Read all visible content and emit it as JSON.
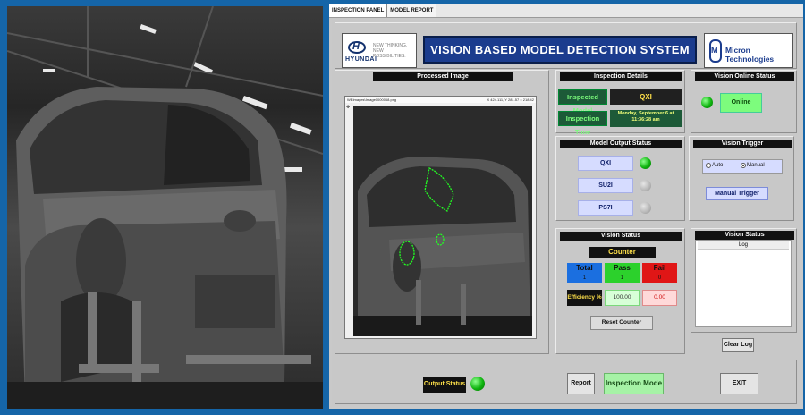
{
  "tabs": [
    "INSPECTION PANEL",
    "MODEL REPORT"
  ],
  "header": {
    "hyundai_brand": "HYUNDAI",
    "hyundai_tagline": "NEW THINKING. NEW POSSIBILITIES.",
    "title": "VISION BASED MODEL DETECTION SYSTEM",
    "company": "Micron Technologies"
  },
  "processed_image": {
    "title": "Processed Image",
    "file_path": "WEImages\\Image0000068.png",
    "coords": "X 424.111, Y 281.57 = 218.42"
  },
  "inspection_details": {
    "title": "Inspection Details",
    "model_label": "Inspected Model",
    "model_value": "QXI",
    "time_label": "Inspection Time",
    "time_value": "Monday, September 6 at 11:36:28 am"
  },
  "vision_online": {
    "title": "Vision Online Status",
    "status": "Online",
    "led_color": "#1ecb1e"
  },
  "model_output": {
    "title": "Model Output Status",
    "models": [
      {
        "name": "QXI",
        "active": true
      },
      {
        "name": "SU2I",
        "active": false
      },
      {
        "name": "PS7I",
        "active": false
      }
    ]
  },
  "vision_trigger": {
    "title": "Vision Trigger",
    "auto_label": "Auto",
    "manual_label": "Manual",
    "selected": "Manual",
    "manual_trigger_label": "Manual Trigger"
  },
  "vision_status_counter": {
    "title": "Vision Status",
    "counter_label": "Counter",
    "total_label": "Total",
    "total_value": "1",
    "pass_label": "Pass",
    "pass_value": "1",
    "fail_label": "Fail",
    "fail_value": "0",
    "efficiency_label": "Efficiency %",
    "pass_efficiency": "100.00",
    "fail_efficiency": "0.00",
    "reset_label": "Reset Counter",
    "colors": {
      "total": "#1b6fe0",
      "pass": "#2cd12c",
      "fail": "#e01616"
    }
  },
  "vision_status_log": {
    "title": "Vision Status",
    "log_header": "Log",
    "clear_label": "Clear Log"
  },
  "bottom": {
    "output_status_label": "Output Status",
    "report_label": "Report",
    "inspection_mode_label": "Inspection Mode",
    "exit_label": "EXIT"
  }
}
